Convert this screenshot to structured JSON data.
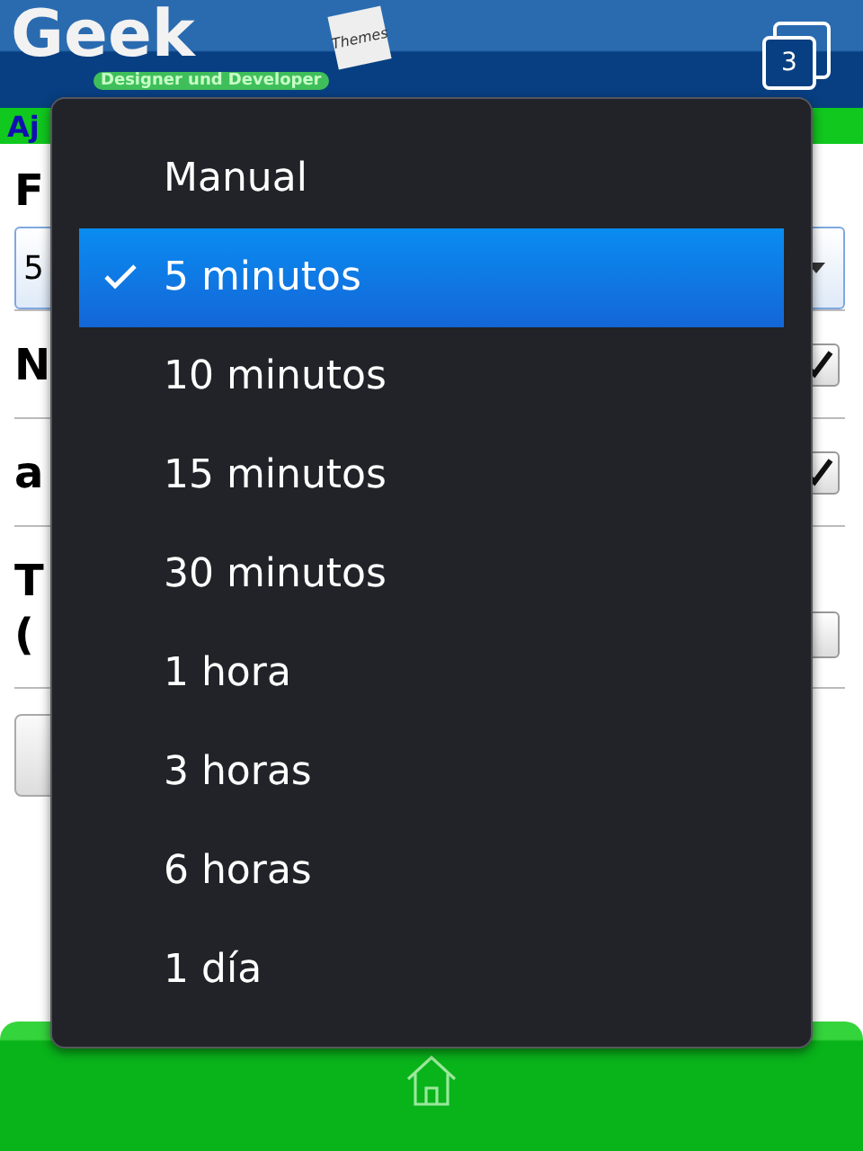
{
  "header": {
    "logo": "Geek",
    "tagline": "Designer und Developer",
    "note": "Themes",
    "badge": "3"
  },
  "subheader": {
    "title": "Aj"
  },
  "form": {
    "label": "F",
    "select_value": "5",
    "rows": [
      {
        "kind": "checkbox",
        "label": "N",
        "checked": true
      },
      {
        "kind": "checkbox",
        "label": "a",
        "checked": true
      },
      {
        "kind": "field",
        "label": "T",
        "label_line2": "("
      }
    ]
  },
  "menu": {
    "items": [
      {
        "label": "Manual",
        "selected": false
      },
      {
        "label": "5 minutos",
        "selected": true
      },
      {
        "label": "10 minutos",
        "selected": false
      },
      {
        "label": "15 minutos",
        "selected": false
      },
      {
        "label": "30 minutos",
        "selected": false
      },
      {
        "label": "1 hora",
        "selected": false
      },
      {
        "label": "3 horas",
        "selected": false
      },
      {
        "label": "6 horas",
        "selected": false
      },
      {
        "label": "1 día",
        "selected": false
      }
    ]
  }
}
